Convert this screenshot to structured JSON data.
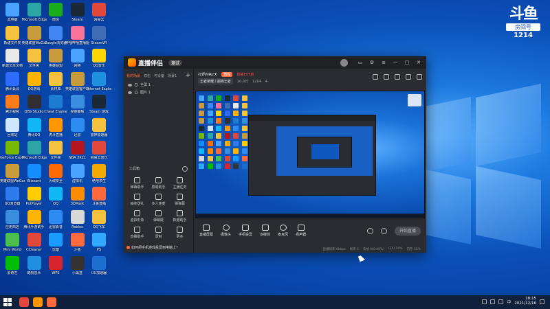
{
  "desktop": {
    "icons": [
      {
        "label": "此电脑",
        "color": "#4aa3ff"
      },
      {
        "label": "Microsoft Edge",
        "color": "#2ca6a4"
      },
      {
        "label": "微信",
        "color": "#1aad19"
      },
      {
        "label": "Steam",
        "color": "#1b2838"
      },
      {
        "label": "网易云",
        "color": "#e2483a"
      },
      {
        "label": "新建文件夹",
        "color": "#f4c23f"
      },
      {
        "label": "英雄联盟WeGame",
        "color": "#c89b3c"
      },
      {
        "label": "Google浏览器",
        "color": "#4285f4"
      },
      {
        "label": "哔哩哔哩直播姬",
        "color": "#fb7299"
      },
      {
        "label": "SteamVR",
        "color": "#3d6db5"
      },
      {
        "label": "新建文本文档",
        "color": "#e8e8e8"
      },
      {
        "label": "文件夹",
        "color": "#f4c23f"
      },
      {
        "label": "英雄联盟",
        "color": "#c89b3c"
      },
      {
        "label": "网络",
        "color": "#4aa3ff"
      },
      {
        "label": "QQ音乐",
        "color": "#ffd600"
      },
      {
        "label": "腾讯会议",
        "color": "#2f6bff"
      },
      {
        "label": "QQ游戏",
        "color": "#ffb400"
      },
      {
        "label": "素材库",
        "color": "#f4c23f"
      },
      {
        "label": "英雄联盟客户端",
        "color": "#c89b3c"
      },
      {
        "label": "Internet Explorer",
        "color": "#1f8fe0"
      },
      {
        "label": "腾讯视频",
        "color": "#ff7c19"
      },
      {
        "label": "OBS Studio",
        "color": "#302e31"
      },
      {
        "label": "Cheat Engine",
        "color": "#1e7bd2"
      },
      {
        "label": "控制面板",
        "color": "#3b8de0"
      },
      {
        "label": "Steam 游戏",
        "color": "#1b2838"
      },
      {
        "label": "回收站",
        "color": "#cfe6ff"
      },
      {
        "label": "腾讯QQ",
        "color": "#12b7f5"
      },
      {
        "label": "虎牙直播",
        "color": "#ff9600"
      },
      {
        "label": "迅雷",
        "color": "#2e8cf0"
      },
      {
        "label": "雷神加速器",
        "color": "#f4c23f"
      },
      {
        "label": "GeForce Experience",
        "color": "#76b900"
      },
      {
        "label": "Microsoft Edge",
        "color": "#2ca6a4"
      },
      {
        "label": "文件夹",
        "color": "#f4c23f"
      },
      {
        "label": "NBA 2K21",
        "color": "#b4161b"
      },
      {
        "label": "网易云音乐",
        "color": "#e2483a"
      },
      {
        "label": "英雄联盟WeGame版",
        "color": "#c89b3c"
      },
      {
        "label": "Blizzard",
        "color": "#148eff"
      },
      {
        "label": "火绒安全",
        "color": "#ff6a00"
      },
      {
        "label": "虚拟机",
        "color": "#4aa3ff"
      },
      {
        "label": "绝地求生",
        "color": "#f2a900"
      },
      {
        "label": "QQ浏览器",
        "color": "#2e7bf0"
      },
      {
        "label": "PotPlayer",
        "color": "#ffcc00"
      },
      {
        "label": "QQ",
        "color": "#12b7f5"
      },
      {
        "label": "3DMark",
        "color": "#ff8c00"
      },
      {
        "label": "斗鱼直播",
        "color": "#ff6a3d"
      },
      {
        "label": "应用商店",
        "color": "#3b8de0"
      },
      {
        "label": "腾讯手游助手",
        "color": "#ffb400"
      },
      {
        "label": "迅雷影音",
        "color": "#2e8cf0"
      },
      {
        "label": "Roblox",
        "color": "#d8d8d8"
      },
      {
        "label": "QQ飞车",
        "color": "#f4c23f"
      },
      {
        "label": "Mini World",
        "color": "#4bbf4b"
      },
      {
        "label": "CCleaner",
        "color": "#e2483a"
      },
      {
        "label": "优酷",
        "color": "#1a9bff"
      },
      {
        "label": "斗鱼",
        "color": "#ff6a3d"
      },
      {
        "label": "PS",
        "color": "#31a8ff"
      },
      {
        "label": "爱奇艺",
        "color": "#00be06"
      },
      {
        "label": "酷狗音乐",
        "color": "#1f8fe0"
      },
      {
        "label": "WPS",
        "color": "#d8262e"
      },
      {
        "label": "小黑盒",
        "color": "#333333"
      },
      {
        "label": "UU加速器",
        "color": "#1c6dd0"
      }
    ]
  },
  "watermark": {
    "logo": "斗鱼",
    "room_label": "房间号",
    "room_no": "1214"
  },
  "app": {
    "name": "直播伴侣",
    "version": "测试",
    "scene_tabs": [
      "我的场景",
      "双击",
      "可设备",
      "场景1"
    ],
    "sources": [
      "全屏 1",
      "图片 1"
    ],
    "toolbox_title": "工具箱",
    "tools": [
      "弹幕助手",
      "感谢助手",
      "主播任务",
      "抽奖送礼",
      "多人连麦",
      "弹弹幕",
      "虚拟形象",
      "弹幕姬",
      "数据助手",
      "直播助手",
      "录制",
      "更多"
    ],
    "notice": "如何把手机游戏投屏到电脑上？",
    "room_title": "打野的第2天",
    "room_tag": "教程",
    "live_tag": "直播已开启",
    "category": "王者荣耀 / 巅峰王者",
    "fans": "10.0万",
    "room_no": "1214",
    "count": "4",
    "controls": [
      "直播屏幕",
      "摄像头",
      "手机投屏",
      "多媒体",
      "麦克风",
      "扬声器"
    ],
    "start_label": "开始直播",
    "status": [
      "直播码率 0kbps",
      "帧率 0",
      "丢帧 0(0.00%)",
      "CPU 10%",
      "内存 55%"
    ]
  },
  "taskbar": {
    "apps": [
      {
        "color": "#e2483a"
      },
      {
        "color": "#ff9600"
      },
      {
        "color": "#ff6a3d"
      }
    ],
    "tray_lang": "中",
    "time": "18:15",
    "date": "2021/12/16"
  }
}
